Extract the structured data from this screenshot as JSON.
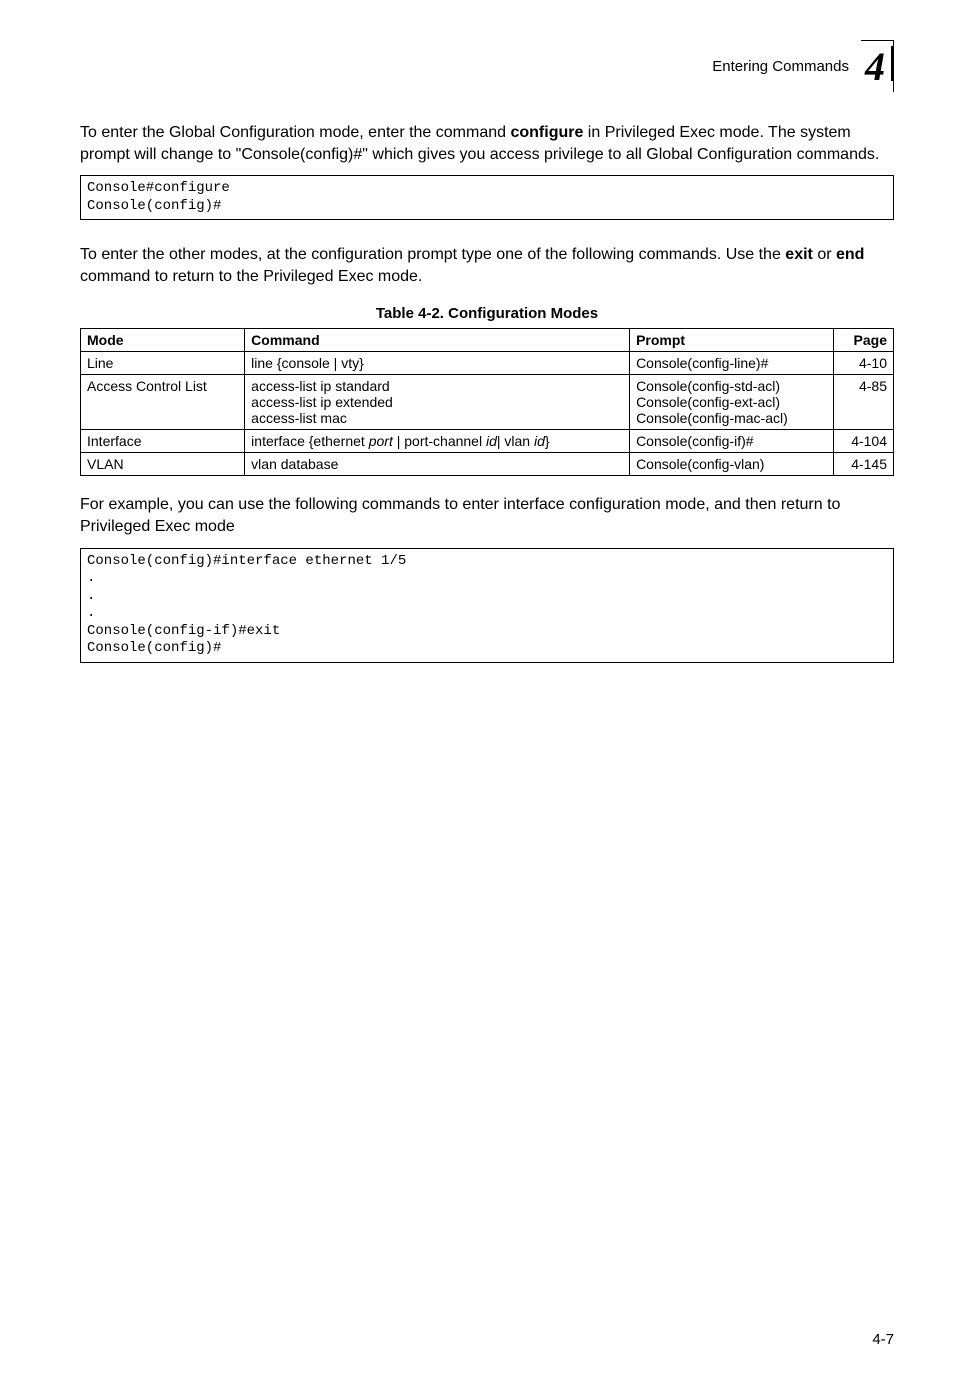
{
  "header": {
    "section": "Entering Commands",
    "chapter": "4"
  },
  "para1_pre": "To enter the Global Configuration mode, enter the command ",
  "para1_bold": "configure",
  "para1_post": " in Privileged Exec mode. The system prompt will change to \"Console(config)#\" which gives you access privilege to all Global Configuration commands.",
  "code1": "Console#configure\nConsole(config)#",
  "para2_pre": "To enter the other modes, at the configuration prompt type one of the following commands. Use the ",
  "para2_b1": "exit",
  "para2_mid": " or ",
  "para2_b2": "end",
  "para2_post": " command to return to the Privileged Exec mode.",
  "table": {
    "caption": "Table 4-2.  Configuration Modes",
    "headers": {
      "mode": "Mode",
      "command": "Command",
      "prompt": "Prompt",
      "page": "Page"
    },
    "rows": [
      {
        "mode": "Line",
        "cmd1": "line {console | vty}",
        "prompt1": "Console(config-line)#",
        "page": "4-10"
      },
      {
        "mode": "Access Control List",
        "cmd1": "access-list ip standard",
        "cmd2": "access-list ip extended",
        "cmd3": "access-list mac",
        "prompt1": "Console(config-std-acl)",
        "prompt2": "Console(config-ext-acl)",
        "prompt3": "Console(config-mac-acl)",
        "page": "4-85"
      },
      {
        "mode": "Interface",
        "cmd_pre": "interface {ethernet ",
        "cmd_i1": "port",
        "cmd_mid1": " | port-channel ",
        "cmd_i2": "id",
        "cmd_mid2": "| vlan ",
        "cmd_i3": "id",
        "cmd_post": "}",
        "prompt1": "Console(config-if)#",
        "page": "4-104"
      },
      {
        "mode": "VLAN",
        "cmd1": "vlan database",
        "prompt1": "Console(config-vlan)",
        "page": "4-145"
      }
    ]
  },
  "para3": "For example, you can use the following commands to enter interface configuration mode, and then return to Privileged Exec mode",
  "code2": "Console(config)#interface ethernet 1/5\n.\n.\n.\nConsole(config-if)#exit\nConsole(config)#",
  "pagenum": "4-7"
}
